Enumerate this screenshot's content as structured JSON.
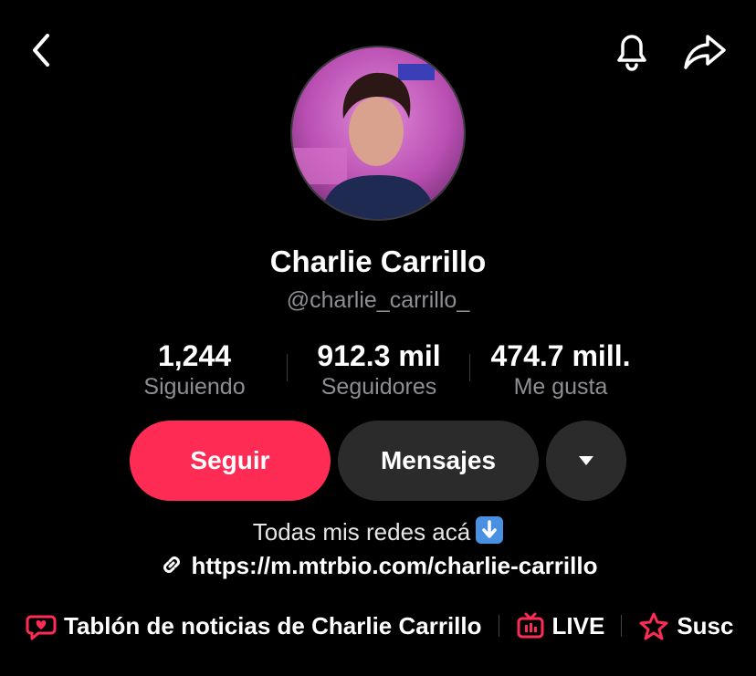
{
  "profile": {
    "display_name": "Charlie Carrillo",
    "username": "@charlie_carrillo_"
  },
  "stats": [
    {
      "value": "1,244",
      "label": "Siguiendo"
    },
    {
      "value": "912.3 mil",
      "label": "Seguidores"
    },
    {
      "value": "474.7 mill.",
      "label": "Me gusta"
    }
  ],
  "actions": {
    "follow_label": "Seguir",
    "message_label": "Mensajes"
  },
  "bio": {
    "text": "Todas mis redes acá",
    "link": "https://m.mtrbio.com/charlie-carrillo"
  },
  "bottom_links": {
    "board": "Tablón de noticias de Charlie Carrillo",
    "live": "LIVE",
    "subs": "Susc"
  },
  "icons": [
    "back-icon",
    "bell-icon",
    "share-icon",
    "dropdown-icon",
    "link-icon",
    "chat-heart-icon",
    "live-tv-icon",
    "star-icon"
  ],
  "colors": {
    "accent": "#fe2c55",
    "secondary_button": "#2b2b2b",
    "muted_text": "#8e8e93"
  }
}
